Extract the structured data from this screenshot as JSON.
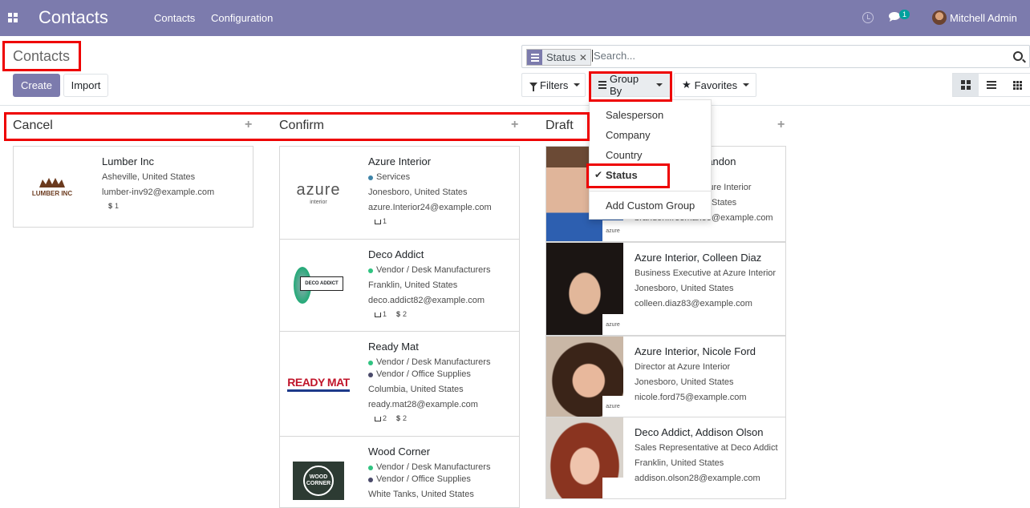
{
  "navbar": {
    "app_title": "Contacts",
    "menu": [
      "Contacts",
      "Configuration"
    ],
    "chat_badge": "1",
    "user": "Mitchell Admin"
  },
  "control_panel": {
    "breadcrumb": "Contacts",
    "create_label": "Create",
    "import_label": "Import",
    "search": {
      "facet": "Status",
      "placeholder": "Search..."
    },
    "filters_label": "Filters",
    "groupby_label": "Group By",
    "favorites_label": "Favorites"
  },
  "groupby_menu": {
    "items": [
      "Salesperson",
      "Company",
      "Country",
      "Status"
    ],
    "checked": "Status",
    "custom": "Add Custom Group"
  },
  "columns": [
    {
      "title": "Cancel",
      "cards": [
        {
          "name": "Lumber Inc",
          "logo_text": "LUMBER INC",
          "lines": [
            "Asheville, United States",
            "lumber-inv92@example.com"
          ],
          "tags": [],
          "orders": "",
          "invoices": "1"
        }
      ]
    },
    {
      "title": "Confirm",
      "cards": [
        {
          "name": "Azure Interior",
          "logo_text": "azure",
          "logo_sub": "interior",
          "tags": [
            {
              "label": "Services",
              "color": "#3f84a8"
            }
          ],
          "lines": [
            "Jonesboro, United States",
            "azure.Interior24@example.com"
          ],
          "orders": "1",
          "invoices": ""
        },
        {
          "name": "Deco Addict",
          "logo_text": "DECO ADDICT",
          "tags": [
            {
              "label": "Vendor / Desk Manufacturers",
              "color": "#30c381"
            }
          ],
          "lines": [
            "Franklin, United States",
            "deco.addict82@example.com"
          ],
          "orders": "1",
          "invoices": "2"
        },
        {
          "name": "Ready Mat",
          "logo_text": "READY MAT",
          "tags": [
            {
              "label": "Vendor / Desk Manufacturers",
              "color": "#30c381"
            },
            {
              "label": "Vendor / Office Supplies",
              "color": "#4a4a6a"
            }
          ],
          "lines": [
            "Columbia, United States",
            "ready.mat28@example.com"
          ],
          "orders": "2",
          "invoices": "2"
        },
        {
          "name": "Wood Corner",
          "logo_text": "WOOD CORNER",
          "tags": [
            {
              "label": "Vendor / Desk Manufacturers",
              "color": "#30c381"
            },
            {
              "label": "Vendor / Office Supplies",
              "color": "#4a4a6a"
            }
          ],
          "lines": [
            "White Tanks, United States"
          ],
          "orders": "",
          "invoices": ""
        }
      ]
    },
    {
      "title": "Draft",
      "cards": [
        {
          "name": "Azure Interior, Brandon Freeman",
          "lines": [
            "Creative Director at Azure Interior",
            "Jonesboro, United States",
            "brandon.freeman55@example.com"
          ]
        },
        {
          "name": "Azure Interior, Colleen Diaz",
          "lines": [
            "Business Executive at Azure Interior",
            "Jonesboro, United States",
            "colleen.diaz83@example.com"
          ]
        },
        {
          "name": "Azure Interior, Nicole Ford",
          "lines": [
            "Director at Azure Interior",
            "Jonesboro, United States",
            "nicole.ford75@example.com"
          ]
        },
        {
          "name": "Deco Addict, Addison Olson",
          "lines": [
            "Sales Representative at Deco Addict",
            "Franklin, United States",
            "addison.olson28@example.com"
          ]
        }
      ]
    }
  ],
  "draft_visible": {
    "c1_title_partial": "randon",
    "c1_line1_partial": "t Azure Interior",
    "c1_line2_partial": "States"
  },
  "mini_logo_text": "azure",
  "colors": {
    "brand": "#7c7bad",
    "highlight": "#e00000"
  }
}
